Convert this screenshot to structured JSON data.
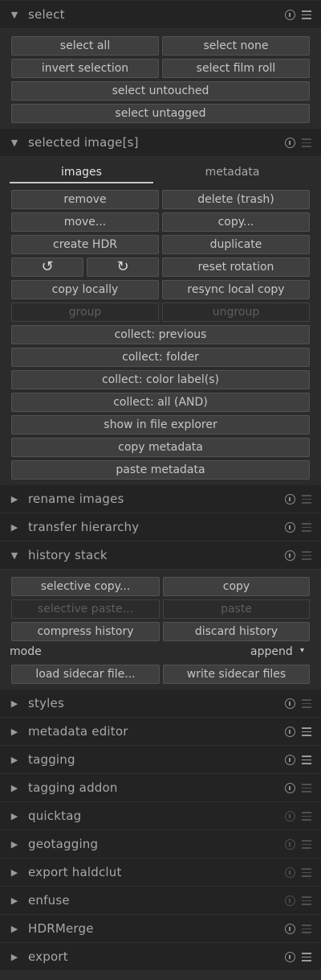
{
  "modules": {
    "select": {
      "title": "select",
      "arrow": "▼",
      "buttons": {
        "select_all": "select all",
        "select_none": "select none",
        "invert_selection": "invert selection",
        "select_film_roll": "select film roll",
        "select_untouched": "select untouched",
        "select_untagged": "select untagged"
      }
    },
    "selected_images": {
      "title": "selected image[s]",
      "arrow": "▼",
      "tabs": {
        "images": "images",
        "metadata": "metadata"
      },
      "buttons": {
        "remove": "remove",
        "delete_trash": "delete (trash)",
        "move": "move...",
        "copy": "copy...",
        "create_hdr": "create HDR",
        "duplicate": "duplicate",
        "rotate_ccw": "↺",
        "rotate_cw": "↻",
        "reset_rotation": "reset rotation",
        "copy_locally": "copy locally",
        "resync_local_copy": "resync local copy",
        "group": "group",
        "ungroup": "ungroup",
        "collect_previous": "collect: previous",
        "collect_folder": "collect: folder",
        "collect_color_label": "collect: color label(s)",
        "collect_all_and": "collect: all (AND)",
        "show_in_file_explorer": "show in file explorer",
        "copy_metadata": "copy metadata",
        "paste_metadata": "paste metadata"
      }
    },
    "rename_images": {
      "title": "rename images",
      "arrow": "▶"
    },
    "transfer_hierarchy": {
      "title": "transfer hierarchy",
      "arrow": "▶"
    },
    "history_stack": {
      "title": "history stack",
      "arrow": "▼",
      "buttons": {
        "selective_copy": "selective copy...",
        "copy": "copy",
        "selective_paste": "selective paste...",
        "paste": "paste",
        "compress_history": "compress history",
        "discard_history": "discard history",
        "load_sidecar": "load sidecar file...",
        "write_sidecar": "write sidecar files"
      },
      "mode_label": "mode",
      "mode_value": "append",
      "mode_caret": "▾"
    },
    "styles": {
      "title": "styles",
      "arrow": "▶"
    },
    "metadata_editor": {
      "title": "metadata editor",
      "arrow": "▶"
    },
    "tagging": {
      "title": "tagging",
      "arrow": "▶"
    },
    "tagging_addon": {
      "title": "tagging addon",
      "arrow": "▶"
    },
    "quicktag": {
      "title": "quicktag",
      "arrow": "▶"
    },
    "geotagging": {
      "title": "geotagging",
      "arrow": "▶"
    },
    "export_haldclut": {
      "title": "export haldclut",
      "arrow": "▶"
    },
    "enfuse": {
      "title": "enfuse",
      "arrow": "▶"
    },
    "hdrmerge": {
      "title": "HDRMerge",
      "arrow": "▶"
    },
    "export": {
      "title": "export",
      "arrow": "▶"
    }
  }
}
